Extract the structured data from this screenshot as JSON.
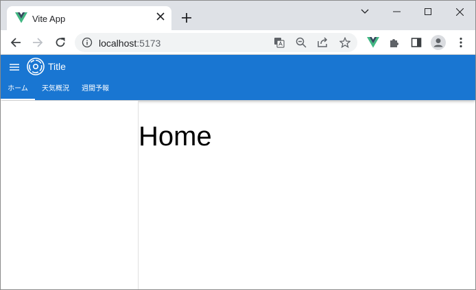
{
  "browser": {
    "tab": {
      "title": "Vite App",
      "favicon": "vue-logo-icon"
    },
    "new_tab_label": "+",
    "address": {
      "host": "localhost",
      "port": ":5173"
    }
  },
  "app": {
    "title": "Title",
    "tabs": [
      {
        "label": "ホーム",
        "active": true
      },
      {
        "label": "天気概況",
        "active": false
      },
      {
        "label": "週間予報",
        "active": false
      }
    ],
    "colors": {
      "appbar": "#1976d2",
      "vue_green": "#41b883",
      "vue_dark": "#35495e"
    }
  },
  "main": {
    "heading": "Home"
  }
}
